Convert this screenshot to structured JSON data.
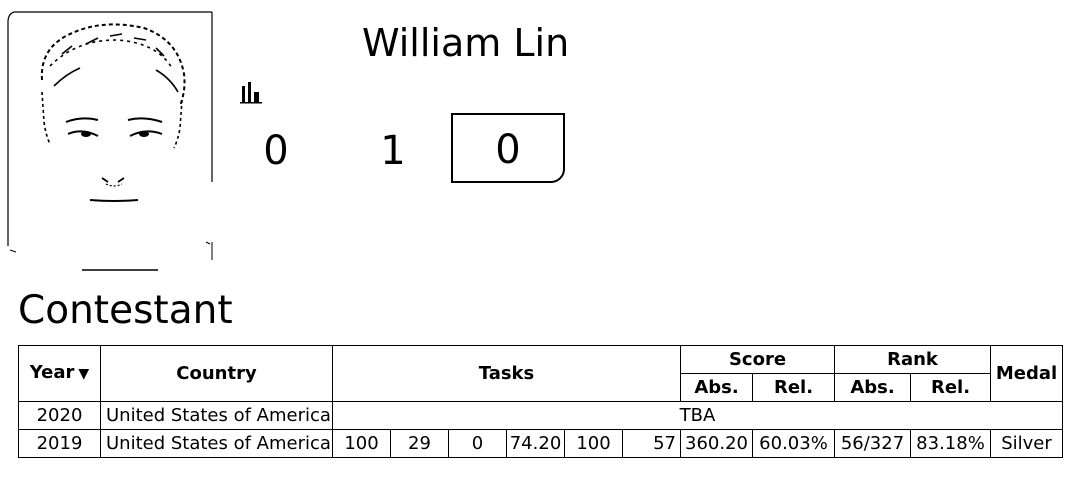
{
  "profile": {
    "name": "William Lin",
    "role": "Contestant",
    "medals": {
      "gold": "0",
      "silver": "1",
      "bronze": "0"
    },
    "icons": {
      "photo": "contestant-photo",
      "stats": "bar-chart-icon"
    }
  },
  "table": {
    "headers": {
      "year": "Year",
      "year_sort": "▼",
      "country": "Country",
      "tasks": "Tasks",
      "score": "Score",
      "rank": "Rank",
      "medal": "Medal",
      "abs": "Abs.",
      "rel": "Rel."
    },
    "rows": [
      {
        "year": "2020",
        "country": "United States of America",
        "status": "TBA"
      },
      {
        "year": "2019",
        "country": "United States of America",
        "tasks": [
          "100",
          "29",
          "0",
          "74.20",
          "100",
          "57"
        ],
        "score_abs": "360.20",
        "score_rel": "60.03%",
        "rank_abs": "56/327",
        "rank_rel": "83.18%",
        "medal": "Silver"
      }
    ]
  }
}
